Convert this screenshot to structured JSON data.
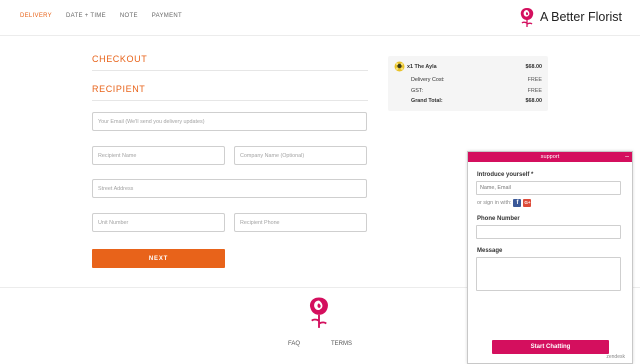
{
  "nav": {
    "steps": [
      "DELIVERY",
      "DATE + TIME",
      "NOTE",
      "PAYMENT"
    ],
    "active_step": "DELIVERY",
    "brand_name": "A Better Florist",
    "brand_color": "#d40f5e",
    "brand_icon": "rose-logo-icon"
  },
  "checkout": {
    "title": "CHECKOUT",
    "section": "RECIPIENT",
    "fields": {
      "email_placeholder": "Your Email (We'll send you delivery updates)",
      "recipient_name_placeholder": "Recipient Name",
      "company_placeholder": "Company Name (Optional)",
      "street_placeholder": "Street Address",
      "unit_placeholder": "Unit Number",
      "phone_placeholder": "Recipient Phone"
    },
    "next_label": "NEXT",
    "accent_color": "#e8631a"
  },
  "summary": {
    "item_name": "x1 The Ayla",
    "item_price": "$68.00",
    "item_icon": "flower-bouquet-icon",
    "rows": [
      {
        "label": "Delivery Cost:",
        "value": "FREE"
      },
      {
        "label": "GST:",
        "value": "FREE"
      },
      {
        "label": "Grand Total:",
        "value": "$68.00"
      }
    ]
  },
  "footer": {
    "links": [
      "FAQ",
      "TERMS"
    ]
  },
  "chat": {
    "header": "support",
    "minimize": "–",
    "intro_label": "Introduce yourself *",
    "name_email_placeholder": "Name, Email",
    "signin_text": "or sign in with:",
    "facebook": "f",
    "google": "G+",
    "phone_label": "Phone Number",
    "message_label": "Message",
    "start_label": "Start Chatting",
    "credit": "zendesk"
  }
}
